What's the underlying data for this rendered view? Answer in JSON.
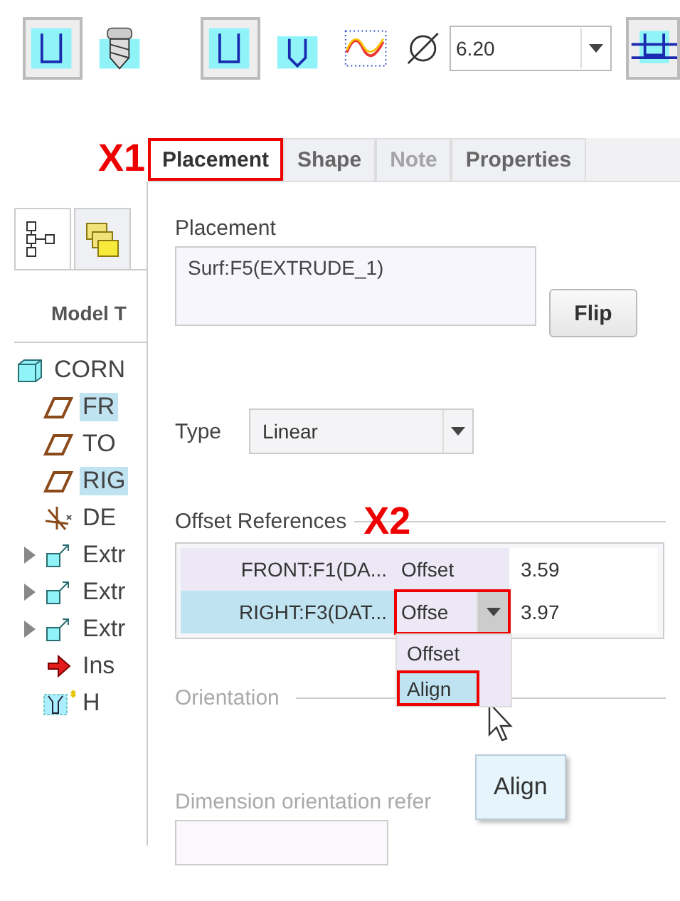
{
  "toolbar": {
    "buttons": [
      {
        "kind": "channel",
        "pressed": true
      },
      {
        "kind": "drill",
        "pressed": false
      },
      {
        "kind": "channel",
        "pressed": true
      },
      {
        "kind": "vee",
        "pressed": false
      },
      {
        "kind": "thread",
        "pressed": false
      }
    ],
    "diameter": {
      "value": "6.20"
    },
    "end_button": {
      "kind": "counterbore",
      "pressed": true
    }
  },
  "annotations": [
    {
      "label": "X1"
    },
    {
      "label": "X2"
    }
  ],
  "tabs": [
    {
      "label": "Placement",
      "selected": true,
      "disabled": false,
      "marked": true
    },
    {
      "label": "Shape",
      "selected": false,
      "disabled": false,
      "marked": false
    },
    {
      "label": "Note",
      "selected": false,
      "disabled": true,
      "marked": false
    },
    {
      "label": "Properties",
      "selected": false,
      "disabled": false,
      "marked": false
    }
  ],
  "sidebar": {
    "tabs": [
      {
        "kind": "tree",
        "selected": true
      },
      {
        "kind": "folders",
        "selected": false
      }
    ],
    "header": "Model T",
    "tree": [
      {
        "label": "CORN",
        "kind": "part",
        "selected": false,
        "children": [
          {
            "label": "FR",
            "kind": "plane",
            "selected": true
          },
          {
            "label": "TO",
            "kind": "plane",
            "selected": false
          },
          {
            "label": "RIG",
            "kind": "plane",
            "selected": true
          },
          {
            "label": "DE",
            "kind": "csys",
            "selected": false
          },
          {
            "label": "Extr",
            "kind": "extrude",
            "selected": false,
            "expanded": false
          },
          {
            "label": "Extr",
            "kind": "extrude",
            "selected": false,
            "expanded": false
          },
          {
            "label": "Extr",
            "kind": "extrude",
            "selected": false,
            "expanded": false
          },
          {
            "label": "Ins",
            "kind": "insert",
            "selected": false
          },
          {
            "label": "H",
            "kind": "hole",
            "selected": false
          }
        ]
      }
    ]
  },
  "placement": {
    "label": "Placement",
    "value": "Surf:F5(EXTRUDE_1)",
    "flip_button": "Flip"
  },
  "type": {
    "label": "Type",
    "value": "Linear"
  },
  "offset_references": {
    "label": "Offset References",
    "rows": [
      {
        "reference": "FRONT:F1(DA...",
        "type": "Offset",
        "value": "3.59",
        "selected": false,
        "marked": false
      },
      {
        "reference": "RIGHT:F3(DAT...",
        "type": "Offse",
        "value": "3.97",
        "selected": true,
        "marked": true,
        "options": [
          {
            "label": "Offset",
            "selected": false,
            "marked": false
          },
          {
            "label": "Align",
            "selected": true,
            "marked": true
          }
        ]
      }
    ]
  },
  "orientation": {
    "label": "Orientation",
    "disabled": true
  },
  "tooltip": "Align",
  "dimension_orientation": {
    "label": "Dimension orientation refer",
    "disabled": true
  }
}
